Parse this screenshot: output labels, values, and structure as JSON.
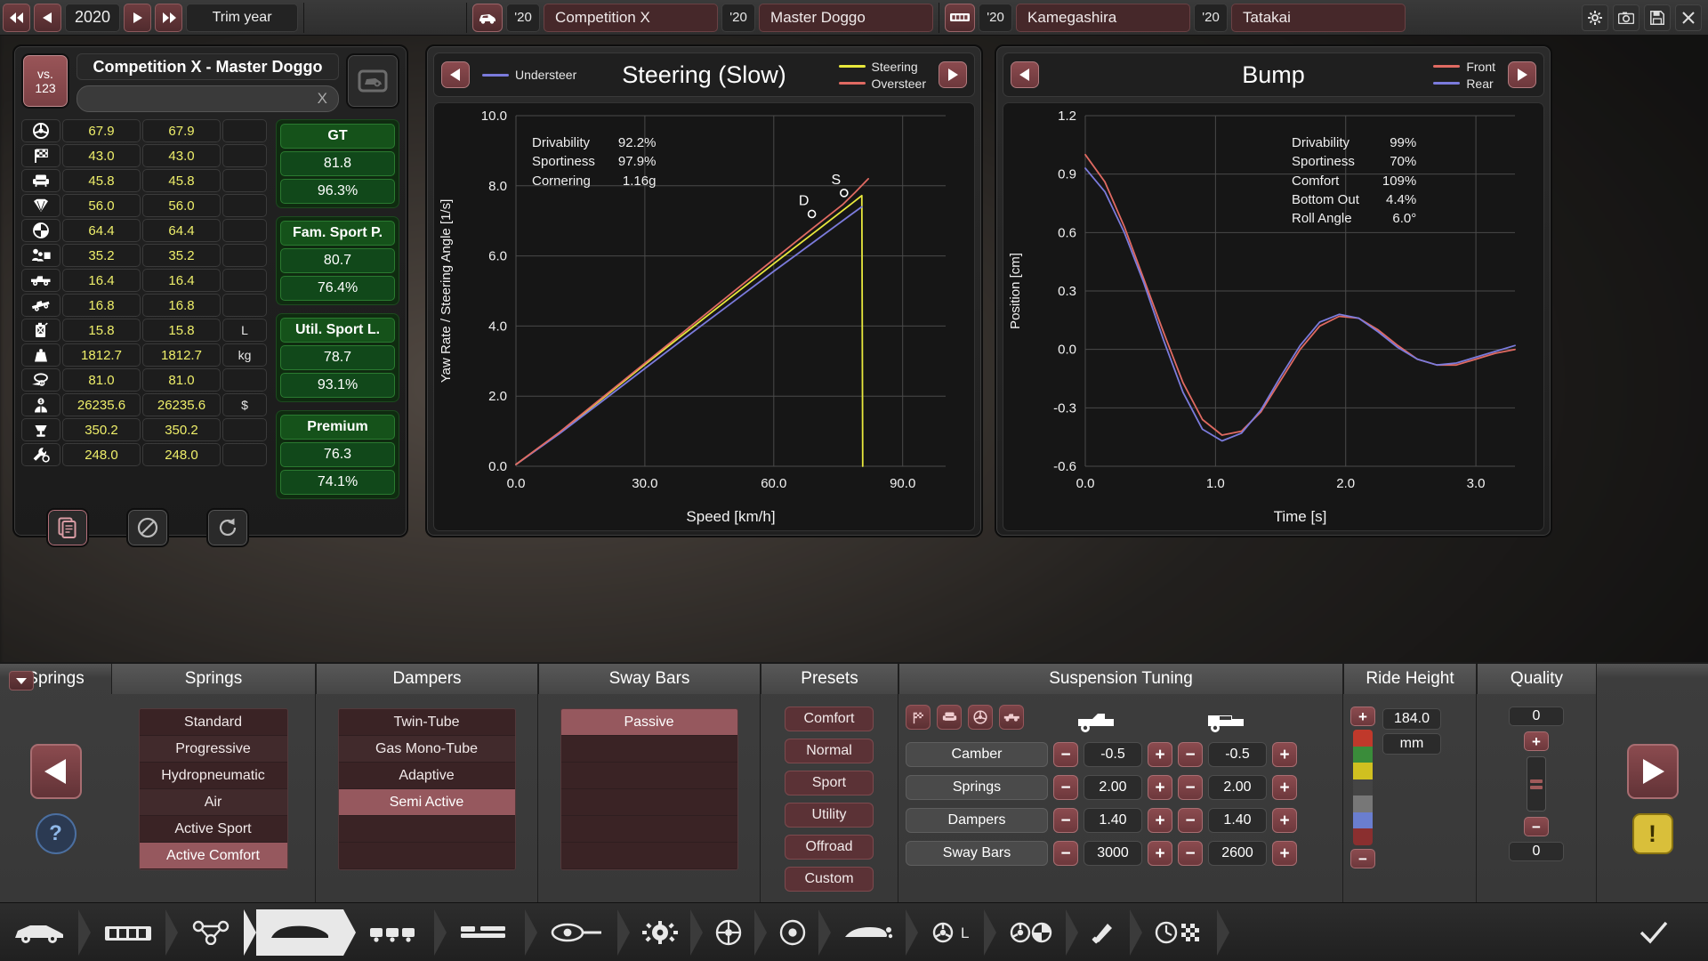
{
  "topbar": {
    "year": "2020",
    "trim_label": "Trim year",
    "first_rewind": "⏪",
    "prev": "◀",
    "next": "▶",
    "last_forward": "⏩",
    "entries": [
      {
        "icon": "car-icon",
        "year": "'20",
        "name": "Competition X"
      },
      {
        "icon": "none",
        "year": "'20",
        "name": "Master Doggo"
      },
      {
        "icon": "engine-icon",
        "year": "'20",
        "name": "Kamegashira"
      },
      {
        "icon": "none",
        "year": "'20",
        "name": "Tatakai"
      }
    ],
    "right_icons": [
      "gear-icon",
      "camera-icon",
      "save-icon",
      "close-icon"
    ]
  },
  "left_panel": {
    "vs_label_top": "vs.",
    "vs_label_bottom": "123",
    "title": "Competition X - Master Doggo",
    "search_value": "",
    "search_clear": "X",
    "photo_icon": "car-photo-icon",
    "rows": [
      {
        "icon": "steering-wheel-icon",
        "a": "67.9",
        "b": "67.9",
        "unit": ""
      },
      {
        "icon": "checkered-flag-icon",
        "a": "43.0",
        "b": "43.0",
        "unit": ""
      },
      {
        "icon": "armchair-icon",
        "a": "45.8",
        "b": "45.8",
        "unit": ""
      },
      {
        "icon": "diamond-icon",
        "a": "56.0",
        "b": "56.0",
        "unit": ""
      },
      {
        "icon": "safety-icon",
        "a": "64.4",
        "b": "64.4",
        "unit": ""
      },
      {
        "icon": "people-icon",
        "a": "35.2",
        "b": "35.2",
        "unit": ""
      },
      {
        "icon": "pickup-icon",
        "a": "16.4",
        "b": "16.4",
        "unit": ""
      },
      {
        "icon": "offroad-icon",
        "a": "16.8",
        "b": "16.8",
        "unit": ""
      },
      {
        "icon": "fuel-can-icon",
        "a": "15.8",
        "b": "15.8",
        "unit": "L"
      },
      {
        "icon": "weight-icon",
        "a": "1812.7",
        "b": "1812.7",
        "unit": "kg"
      },
      {
        "icon": "emissions-icon",
        "a": "81.0",
        "b": "81.0",
        "unit": ""
      },
      {
        "icon": "price-icon",
        "a": "26235.6",
        "b": "26235.6",
        "unit": "$"
      },
      {
        "icon": "podium-icon",
        "a": "350.2",
        "b": "350.2",
        "unit": ""
      },
      {
        "icon": "service-icon",
        "a": "248.0",
        "b": "248.0",
        "unit": ""
      }
    ],
    "stat_groups": [
      {
        "header": "GT",
        "value1": "81.8",
        "value2": "96.3%"
      },
      {
        "header": "Fam. Sport P.",
        "value1": "80.7",
        "value2": "76.4%"
      },
      {
        "header": "Util. Sport L.",
        "value1": "78.7",
        "value2": "93.1%"
      },
      {
        "header": "Premium",
        "value1": "76.3",
        "value2": "74.1%"
      }
    ],
    "foot_buttons": [
      "copy-icon",
      "block-icon",
      "reset-icon"
    ]
  },
  "graph_left": {
    "title": "Steering (Slow)",
    "prev_icon": "prev-arrow-icon",
    "next_icon": "next-arrow-icon",
    "legend_left": [
      {
        "label": "Understeer",
        "color": "#7b7bdc"
      }
    ],
    "legend_right": [
      {
        "label": "Steering",
        "color": "#e8e83c"
      },
      {
        "label": "Oversteer",
        "color": "#e06a62"
      }
    ],
    "info": [
      {
        "label": "Drivability",
        "value": "92.2%"
      },
      {
        "label": "Sportiness",
        "value": "97.9%"
      },
      {
        "label": "Cornering",
        "value": "1.16g"
      }
    ],
    "point_labels": [
      "S",
      "D"
    ]
  },
  "graph_right": {
    "title": "Bump",
    "prev_icon": "prev-arrow-icon",
    "next_icon": "next-arrow-icon",
    "legend_right": [
      {
        "label": "Front",
        "color": "#e06a62"
      },
      {
        "label": "Rear",
        "color": "#7b7bdc"
      }
    ],
    "info": [
      {
        "label": "Drivability",
        "value": "99%"
      },
      {
        "label": "Sportiness",
        "value": "70%"
      },
      {
        "label": "Comfort",
        "value": "109%"
      },
      {
        "label": "Bottom Out",
        "value": "4.4%"
      },
      {
        "label": "Roll Angle",
        "value": "6.0°"
      }
    ]
  },
  "chart_data": [
    {
      "type": "line",
      "title": "Steering (Slow)",
      "xlabel": "Speed [km/h]",
      "ylabel": "Yaw Rate / Steering Angle [1/s]",
      "xlim": [
        0,
        100
      ],
      "ylim": [
        0,
        10
      ],
      "xticks": [
        "0.0",
        "30.0",
        "60.0",
        "90.0"
      ],
      "xtick_values": [
        0,
        30,
        60,
        90
      ],
      "yticks": [
        "0.0",
        "2.0",
        "4.0",
        "6.0",
        "8.0",
        "10.0"
      ],
      "ytick_values": [
        0,
        2,
        4,
        6,
        8,
        10
      ],
      "grid": true,
      "legend_position": "header",
      "series": [
        {
          "name": "Steering",
          "color": "#e8e83c",
          "x": [
            0,
            10,
            20,
            30,
            40,
            50,
            60,
            70,
            78,
            80.5,
            80.7
          ],
          "y": [
            0.05,
            0.95,
            1.92,
            2.9,
            3.86,
            4.82,
            5.78,
            6.72,
            7.48,
            7.72,
            0.0
          ]
        },
        {
          "name": "Understeer",
          "color": "#7b7bdc",
          "x": [
            0,
            10,
            20,
            30,
            40,
            50,
            60,
            70,
            78,
            80.5
          ],
          "y": [
            0.05,
            0.92,
            1.85,
            2.79,
            3.72,
            4.64,
            5.56,
            6.46,
            7.18,
            7.4
          ]
        },
        {
          "name": "Oversteer",
          "color": "#e06a62",
          "x": [
            0,
            10,
            20,
            30,
            40,
            50,
            60,
            70,
            76,
            79,
            82
          ],
          "y": [
            0.05,
            0.96,
            1.95,
            2.94,
            3.93,
            4.92,
            5.9,
            6.88,
            7.46,
            7.82,
            8.2
          ]
        }
      ],
      "annotations": [
        {
          "text": "S",
          "x": 74.5,
          "y": 8.05
        },
        {
          "text": "D",
          "x": 67.0,
          "y": 7.45
        }
      ],
      "info_box": [
        {
          "label": "Drivability",
          "value": "92.2%"
        },
        {
          "label": "Sportiness",
          "value": "97.9%"
        },
        {
          "label": "Cornering",
          "value": "1.16g"
        }
      ]
    },
    {
      "type": "line",
      "title": "Bump",
      "xlabel": "Time [s]",
      "ylabel": "Position [cm]",
      "xlim": [
        0,
        3.3
      ],
      "ylim": [
        -0.6,
        1.2
      ],
      "xticks": [
        "0.0",
        "1.0",
        "2.0",
        "3.0"
      ],
      "xtick_values": [
        0,
        1,
        2,
        3
      ],
      "yticks": [
        "-0.6",
        "-0.3",
        "0.0",
        "0.3",
        "0.6",
        "0.9",
        "1.2"
      ],
      "ytick_values": [
        -0.6,
        -0.3,
        0,
        0.3,
        0.6,
        0.9,
        1.2
      ],
      "grid": true,
      "legend_position": "header",
      "series": [
        {
          "name": "Front",
          "color": "#e06a62",
          "x": [
            0.0,
            0.15,
            0.3,
            0.45,
            0.6,
            0.75,
            0.9,
            1.05,
            1.2,
            1.35,
            1.5,
            1.65,
            1.8,
            1.95,
            2.1,
            2.25,
            2.4,
            2.55,
            2.7,
            2.85,
            3.0,
            3.15,
            3.3
          ],
          "y": [
            1.0,
            0.86,
            0.63,
            0.36,
            0.09,
            -0.17,
            -0.36,
            -0.44,
            -0.42,
            -0.32,
            -0.16,
            0.0,
            0.12,
            0.17,
            0.16,
            0.1,
            0.02,
            -0.05,
            -0.08,
            -0.08,
            -0.05,
            -0.02,
            0.0
          ]
        },
        {
          "name": "Rear",
          "color": "#7b7bdc",
          "x": [
            0.0,
            0.15,
            0.3,
            0.45,
            0.6,
            0.75,
            0.9,
            1.05,
            1.2,
            1.35,
            1.5,
            1.65,
            1.8,
            1.95,
            2.1,
            2.25,
            2.4,
            2.55,
            2.7,
            2.85,
            3.0,
            3.15,
            3.3
          ],
          "y": [
            0.93,
            0.81,
            0.6,
            0.34,
            0.05,
            -0.22,
            -0.41,
            -0.47,
            -0.43,
            -0.31,
            -0.14,
            0.02,
            0.14,
            0.18,
            0.16,
            0.09,
            0.01,
            -0.05,
            -0.08,
            -0.07,
            -0.04,
            -0.01,
            0.02
          ]
        }
      ],
      "info_box": [
        {
          "label": "Drivability",
          "value": "99%"
        },
        {
          "label": "Sportiness",
          "value": "70%"
        },
        {
          "label": "Comfort",
          "value": "109%"
        },
        {
          "label": "Bottom Out",
          "value": "4.4%"
        },
        {
          "label": "Roll Angle",
          "value": "6.0°"
        }
      ]
    }
  ],
  "bottom": {
    "collapse_icon": "chevron-down-icon",
    "columns": [
      {
        "header": "Springs"
      },
      {
        "header": "Dampers"
      },
      {
        "header": "Sway Bars"
      },
      {
        "header": "Presets"
      },
      {
        "header": "Suspension Tuning"
      },
      {
        "header": "Ride Height"
      },
      {
        "header": "Quality"
      }
    ],
    "springs": [
      {
        "label": "Standard",
        "selected": false
      },
      {
        "label": "Progressive",
        "selected": false
      },
      {
        "label": "Hydropneumatic",
        "selected": false
      },
      {
        "label": "Air",
        "selected": false
      },
      {
        "label": "Active Sport",
        "selected": false
      },
      {
        "label": "Active Comfort",
        "selected": true
      }
    ],
    "dampers": [
      {
        "label": "Twin-Tube",
        "selected": false
      },
      {
        "label": "Gas Mono-Tube",
        "selected": false
      },
      {
        "label": "Adaptive",
        "selected": false
      },
      {
        "label": "Semi Active",
        "selected": true
      },
      {
        "label": "",
        "selected": false
      },
      {
        "label": "",
        "selected": false
      }
    ],
    "sway_bars": [
      {
        "label": "Passive",
        "selected": true
      },
      {
        "label": "",
        "selected": false
      },
      {
        "label": "",
        "selected": false
      },
      {
        "label": "",
        "selected": false
      },
      {
        "label": "",
        "selected": false
      },
      {
        "label": "",
        "selected": false
      }
    ],
    "presets": [
      "Comfort",
      "Normal",
      "Sport",
      "Utility",
      "Offroad",
      "Custom"
    ],
    "tuning_axle_icons_left": [
      "checkered-flag-icon",
      "armchair-icon",
      "steering-wheel-icon",
      "pickup-icon"
    ],
    "tuning_axle_front_icon": "front-axle-icon",
    "tuning_axle_rear_icon": "rear-axle-icon",
    "tuning_rows": [
      {
        "label": "Camber",
        "front": "-0.5",
        "rear": "-0.5"
      },
      {
        "label": "Springs",
        "front": "2.00",
        "rear": "2.00"
      },
      {
        "label": "Dampers",
        "front": "1.40",
        "rear": "1.40"
      },
      {
        "label": "Sway Bars",
        "front": "3000",
        "rear": "2600"
      }
    ],
    "ride_height": {
      "value": "184.0",
      "unit": "mm",
      "plus": "+",
      "minus": "−"
    },
    "quality": {
      "top": "0",
      "bottom": "0",
      "plus": "+",
      "minus": "−"
    },
    "nav_prev_icon": "big-prev-arrow-icon",
    "nav_next_icon": "big-next-arrow-icon",
    "help_label": "?",
    "warn_label": "!"
  },
  "nav": {
    "items": [
      {
        "icon": "car-body-icon",
        "active": false
      },
      {
        "icon": "engine-block-icon",
        "active": false
      },
      {
        "icon": "chassis-icon",
        "active": false
      },
      {
        "icon": "body-shape-icon",
        "active": true
      },
      {
        "icon": "suspension-icon",
        "active": false
      },
      {
        "icon": "interior-icon",
        "active": false
      },
      {
        "icon": "drivetrain-icon",
        "active": false
      },
      {
        "icon": "gearbox-icon",
        "active": false
      },
      {
        "icon": "wheel-icon",
        "active": false
      },
      {
        "icon": "brakes-icon",
        "active": false
      },
      {
        "icon": "aero-icon",
        "active": false
      },
      {
        "icon": "weight-dist-icon",
        "active": false
      },
      {
        "icon": "balance-icon",
        "active": false
      },
      {
        "icon": "tuning-icon",
        "active": false
      },
      {
        "icon": "results-icon",
        "active": false
      },
      {
        "icon": "confirm-icon",
        "active": false
      }
    ]
  },
  "colors": {
    "accent_red": "#8b4b4f",
    "green_stat": "#15521a",
    "yellow_value": "#efef6a",
    "steering_yellow": "#e8e83c",
    "understeer_blue": "#7b7bdc",
    "oversteer_red": "#e06a62"
  }
}
